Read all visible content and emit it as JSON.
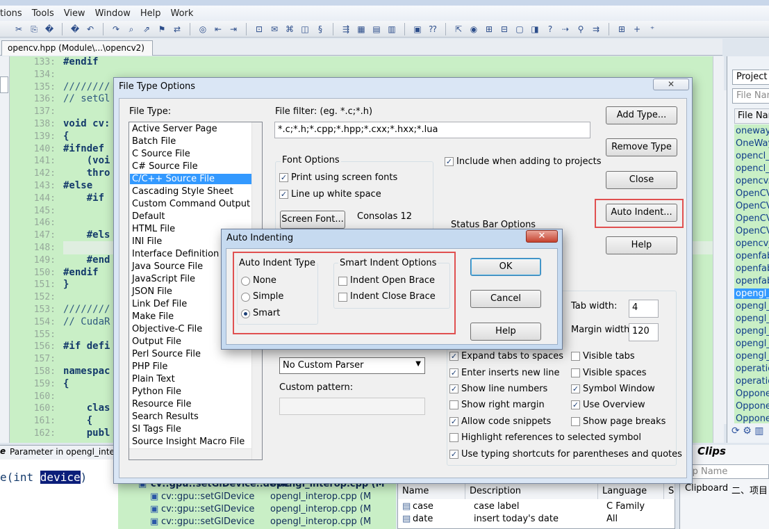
{
  "menu": [
    "tions",
    "Tools",
    "View",
    "Window",
    "Help",
    "Work"
  ],
  "editor": {
    "tab_label": "opencv.hpp (Module\\...\\opencv2)",
    "lines": [
      {
        "n": "133:",
        "t": "#endif",
        "c": false
      },
      {
        "n": "134:",
        "t": "",
        "c": false
      },
      {
        "n": "135:",
        "t": "////////",
        "c": true
      },
      {
        "n": "136:",
        "t": "// setGl",
        "c": true
      },
      {
        "n": "137:",
        "t": "",
        "c": false
      },
      {
        "n": "138:",
        "t": "void cv:",
        "c": false
      },
      {
        "n": "139:",
        "t": "{",
        "c": false
      },
      {
        "n": "140:",
        "t": "#ifndef",
        "c": false
      },
      {
        "n": "141:",
        "t": "    (voi",
        "c": false
      },
      {
        "n": "142:",
        "t": "    thro",
        "c": false
      },
      {
        "n": "143:",
        "t": "#else",
        "c": false
      },
      {
        "n": "144:",
        "t": "    #if",
        "c": false
      },
      {
        "n": "145:",
        "t": "",
        "c": false
      },
      {
        "n": "146:",
        "t": "",
        "c": false
      },
      {
        "n": "147:",
        "t": "    #els",
        "c": false
      },
      {
        "n": "148:",
        "t": "",
        "c": false
      },
      {
        "n": "149:",
        "t": "    #end",
        "c": false
      },
      {
        "n": "150:",
        "t": "#endif",
        "c": false
      },
      {
        "n": "151:",
        "t": "}",
        "c": false
      },
      {
        "n": "152:",
        "t": "",
        "c": false
      },
      {
        "n": "153:",
        "t": "////////",
        "c": true
      },
      {
        "n": "154:",
        "t": "// CudaR",
        "c": true
      },
      {
        "n": "155:",
        "t": "",
        "c": false
      },
      {
        "n": "156:",
        "t": "#if defi",
        "c": false
      },
      {
        "n": "157:",
        "t": "",
        "c": false
      },
      {
        "n": "158:",
        "t": "namespac",
        "c": false
      },
      {
        "n": "159:",
        "t": "{",
        "c": false
      },
      {
        "n": "160:",
        "t": "",
        "c": false
      },
      {
        "n": "160:",
        "t": "    clas",
        "c": false
      },
      {
        "n": "161:",
        "t": "    {",
        "c": false
      },
      {
        "n": "162:",
        "t": "    publ",
        "c": false
      }
    ]
  },
  "project": {
    "title": "Project F",
    "filter_placeholder": "File Nan",
    "column": "File Nar",
    "files": [
      "oneway.",
      "OneWay",
      "opencl_c",
      "opencl_u",
      "opencv.h",
      "OpenCV",
      "OpenCV",
      "OpenCV",
      "OpenCV",
      "opencv_",
      "openfab",
      "openfab",
      "openfab",
      "opengl_i",
      "opengl_i",
      "opengl_i",
      "opengl_i",
      "opengl_i",
      "opengl_i",
      "operatio",
      "operatio",
      "Oppone",
      "Oppone",
      "Oppone"
    ],
    "selected_index": 13
  },
  "bottom": {
    "param_tab": "Parameter in opengl_interop",
    "param_tab_prefix": "e",
    "param_code_pre": "e(int ",
    "param_code_hl": "device",
    "param_code_post": ")",
    "symbols": [
      {
        "name": "cv::gpu::setGlDevice..devic",
        "file": "opengl_interop.cpp (M"
      },
      {
        "name": "cv::gpu::setGlDevice",
        "file": "opengl_interop.cpp (M"
      },
      {
        "name": "cv::gpu::setGlDevice",
        "file": "opengl_interop.cpp (M"
      },
      {
        "name": "cv::gpu::setGlDevice",
        "file": "opengl_interop.cpp (M"
      }
    ],
    "clip_columns": [
      "Name",
      "Description",
      "Language",
      "S"
    ],
    "clip_rows": [
      {
        "name": "case",
        "desc": "case label",
        "lang": "C Family"
      },
      {
        "name": "date",
        "desc": "insert today's date",
        "lang": "All"
      }
    ],
    "clips_title": "Clips",
    "clip_name_placeholder": "ip Name",
    "clip_items": [
      "Clipboard",
      "二、项目"
    ]
  },
  "file_type_options": {
    "title": "File Type Options",
    "close": "✕",
    "file_type_label": "File Type:",
    "file_types": [
      "Active Server Page",
      "Batch File",
      "C Source File",
      "C# Source File",
      "C/C++ Source File",
      "Cascading Style Sheet",
      "Custom Command Output",
      "Default",
      "HTML File",
      "INI File",
      "Interface Definition File",
      "Java Source File",
      "JavaScript File",
      "JSON File",
      "Link Def File",
      "Make File",
      "Objective-C File",
      "Output File",
      "Perl Source File",
      "PHP File",
      "Plain Text",
      "Python File",
      "Resource File",
      "Search Results",
      "SI Tags File",
      "Source Insight Macro File"
    ],
    "selected_index": 4,
    "file_filter_label": "File filter: (eg. *.c;*.h)",
    "file_filter_value": "*.c;*.h;*.cpp;*.hpp;*.cxx;*.hxx;*.lua",
    "font_options_label": "Font Options",
    "print_screen_fonts": "Print using screen fonts",
    "line_up_white": "Line up white space",
    "screen_font_button": "Screen Font...",
    "font_name": "Consolas 12",
    "include_projects": "Include when adding to projects",
    "status_bar_label": "Status Bar Options",
    "buttons": {
      "add_type": "Add Type...",
      "remove_type": "Remove Type",
      "close": "Close",
      "auto_indent": "Auto Indent...",
      "help": "Help"
    },
    "tab_width_label": "Tab width:",
    "tab_width": "4",
    "margin_width_label": "Margin width:",
    "margin_width": "120",
    "parser": "No Custom Parser",
    "custom_pattern_label": "Custom pattern:",
    "options": {
      "expand_tabs": "Expand tabs to spaces",
      "visible_tabs": "Visible tabs",
      "enter_inserts": "Enter inserts new line",
      "visible_spaces": "Visible spaces",
      "show_line_numbers": "Show line numbers",
      "symbol_window": "Symbol Window",
      "show_right_margin": "Show right margin",
      "use_overview": "Use Overview",
      "allow_snippets": "Allow code snippets",
      "show_page_breaks": "Show page breaks",
      "highlight_refs": "Highlight references to selected symbol",
      "typing_shortcuts": "Use typing shortcuts for parentheses and quotes"
    }
  },
  "auto_indenting": {
    "title": "Auto Indenting",
    "close": "✕",
    "indent_type_label": "Auto Indent Type",
    "none": "None",
    "simple": "Simple",
    "smart": "Smart",
    "selected": "smart",
    "smart_options_label": "Smart Indent Options",
    "open_brace": "Indent Open Brace",
    "close_brace": "Indent Close Brace",
    "ok": "OK",
    "cancel": "Cancel",
    "help": "Help"
  }
}
